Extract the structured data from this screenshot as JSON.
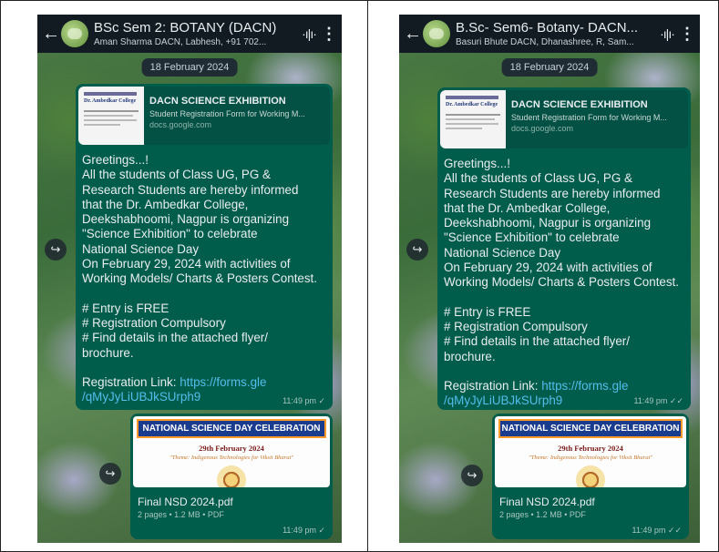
{
  "screens": [
    {
      "header": {
        "title": "BSc Sem 2: BOTANY (DACN)",
        "subtitle": "Aman Sharma DACN, Labhesh, +91 702...",
        "back_glyph": "←",
        "voice_icon_glyph": "·ı|ı·",
        "menu_glyph": "⋮"
      },
      "date": "18 February 2024",
      "forward_glyph": "↪",
      "link_preview": {
        "title": "DACN SCIENCE EXHIBITION",
        "description": "Student Registration Form for Working M...",
        "domain": "docs.google.com",
        "thumb_text": "Dr. Ambedkar College"
      },
      "message": {
        "para1": "Greetings...!\nAll the students of Class UG, PG &\nResearch Students are hereby informed\nthat the Dr. Ambedkar College,\nDeekshabhoomi, Nagpur is organizing\n\"Science Exhibition\" to celebrate\nNational Science Day\nOn February 29, 2024 with activities of\nWorking Models/ Charts & Posters Contest.",
        "para2": "# Entry is FREE\n# Registration Compulsory\n# Find details in the attached flyer/\nbrochure.",
        "reg_label": "Registration Link: ",
        "reg_link": "https://forms.gle\n/qMyJyLiUBJkSUrph9",
        "time": "11:49 pm ✓"
      },
      "pdf": {
        "banner": "NATIONAL SCIENCE DAY CELEBRATION",
        "date_line": "29th February 2024",
        "theme_line": "\"Theme: Indigenous Technologies for Viksit Bharat\"",
        "filename": "Final NSD 2024.pdf",
        "meta": "2 pages • 1.2 MB • PDF",
        "time": "11:49 pm ✓"
      }
    },
    {
      "header": {
        "title": "B.Sc- Sem6- Botany- DACN...",
        "subtitle": "Basuri Bhute DACN, Dhanashree, R, Sam...",
        "back_glyph": "←",
        "voice_icon_glyph": "·ı|ı·",
        "menu_glyph": "⋮"
      },
      "date": "18 February 2024",
      "forward_glyph": "↪",
      "link_preview": {
        "title": "DACN SCIENCE EXHIBITION",
        "description": "Student Registration Form for Working M...",
        "domain": "docs.google.com",
        "thumb_text": "Dr. Ambedkar College"
      },
      "message": {
        "para1": "Greetings...!\nAll the students of Class UG, PG &\nResearch Students are hereby informed\nthat the Dr. Ambedkar College,\nDeekshabhoomi, Nagpur is organizing\n\"Science Exhibition\" to celebrate\nNational Science Day\nOn February 29, 2024 with activities of\nWorking Models/ Charts & Posters Contest.",
        "para2": "# Entry is FREE\n# Registration Compulsory\n# Find details in the attached flyer/\nbrochure.",
        "reg_label": "Registration Link: ",
        "reg_link": "https://forms.gle\n/qMyJyLiUBJkSUrph9",
        "time": "11:49 pm ✓✓"
      },
      "pdf": {
        "banner": "NATIONAL SCIENCE DAY CELEBRATION",
        "date_line": "29th February 2024",
        "theme_line": "\"Theme: Indigenous Technologies for Viksit Bharat\"",
        "filename": "Final NSD 2024.pdf",
        "meta": "2 pages • 1.2 MB • PDF",
        "time": "11:49 pm ✓✓"
      }
    }
  ],
  "colors": {
    "header_bg": "#111b21",
    "bubble_out": "#005c4b",
    "link": "#53bdeb",
    "banner": "#1a3c8f"
  }
}
